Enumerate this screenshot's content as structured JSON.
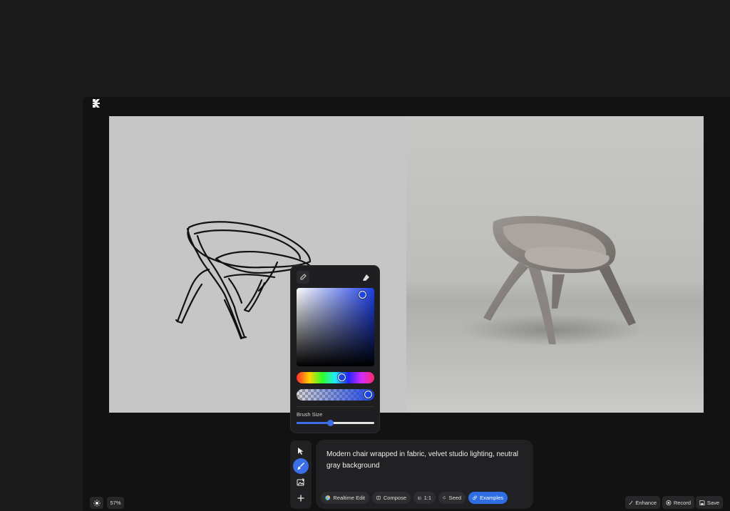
{
  "canvas": {
    "zoom_label": "57%"
  },
  "color_picker": {
    "selected_color": "#1e45e0",
    "hue_position": 0.6,
    "alpha_position": 0.92,
    "brush_size_label": "Brush Size",
    "brush_size_value": 0.44
  },
  "toolbar": {
    "tools": [
      {
        "name": "select",
        "icon": "cursor-arrow-icon",
        "active": false
      },
      {
        "name": "brush",
        "icon": "brush-icon",
        "active": true
      },
      {
        "name": "image",
        "icon": "image-add-icon",
        "active": false
      },
      {
        "name": "add",
        "icon": "plus-icon",
        "active": false
      }
    ]
  },
  "prompt": {
    "text": "Modern chair wrapped in fabric, velvet studio lighting, neutral gray background",
    "chips": {
      "realtime_edit": "Realtime Edit",
      "compose": "Compose",
      "ratio": "1:1",
      "seed": "Seed",
      "examples": "Examples"
    }
  },
  "actions": {
    "enhance": "Enhance",
    "record": "Record",
    "save": "Save"
  },
  "colors": {
    "accent": "#3a6fe8",
    "panel": "#212123",
    "background": "#1c1b1c"
  }
}
